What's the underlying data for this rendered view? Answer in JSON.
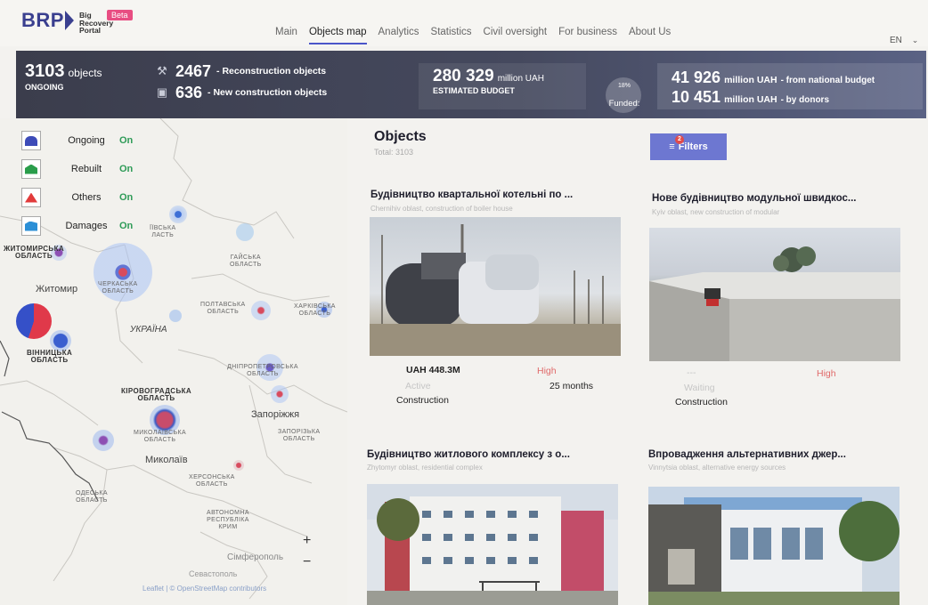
{
  "header": {
    "logo_text": "BRP",
    "logo_lines": [
      "Big",
      "Recovery",
      "Portal"
    ],
    "beta_badge": "Beta",
    "nav": [
      "Main",
      "Objects map",
      "Analytics",
      "Statistics",
      "Civil oversight",
      "For business",
      "About Us"
    ],
    "active_nav": "Objects map",
    "language": "EN"
  },
  "stats": {
    "ongoing_count": "3103",
    "ongoing_unit": "objects",
    "ongoing_label": "ONGOING",
    "reconstruction_count": "2467",
    "reconstruction_label": "- Reconstruction objects",
    "new_count": "636",
    "new_label": "- New construction objects",
    "budget_value": "280 329",
    "budget_unit": "million UAH",
    "budget_label": "ESTIMATED BUDGET",
    "funded_pct": "18%",
    "funded_label": "Funded:",
    "national_value": "41 926",
    "national_unit": "million UAH",
    "national_label": "- from national budget",
    "donors_value": "10 451",
    "donors_unit": "million UAH",
    "donors_label": "- by donors"
  },
  "legend": [
    {
      "label": "Ongoing",
      "state": "On",
      "icon": "ongoing-icon",
      "color": "#3d4bb8"
    },
    {
      "label": "Rebuilt",
      "state": "On",
      "icon": "rebuilt-icon",
      "color": "#2a9d4b"
    },
    {
      "label": "Others",
      "state": "On",
      "icon": "others-icon",
      "color": "#e23b3b"
    },
    {
      "label": "Damages",
      "state": "On",
      "icon": "damages-icon",
      "color": "#2b8fd6"
    }
  ],
  "map": {
    "regions": {
      "kyiv": "ЇЇВСЬКА\nЛАСТЬ",
      "zhytomyr": "ЖИТОМИРСЬКА\nОБЛАСТЬ",
      "chernihiv": "ГАЙСЬКА\nОБЛАСТЬ",
      "poltava": "ПОЛТАВСЬКА\nОБЛАСТЬ",
      "kharkiv": "ХАРКІВСЬКА\nОБЛАСТЬ",
      "cherkasy": "ЧЕРКАСЬКА\nОБЛАСТЬ",
      "vinnytsia": "ВІННИЦЬКА\nОБЛАСТЬ",
      "dnipro": "ДНІПРОПЕТРОВСЬКА\nОБЛАСТЬ",
      "kirovohrad": "КІРОВОГРАДСЬКА\nОБЛАСТЬ",
      "zaporizhzhia": "ЗАПОРІЗЬКА\nОБЛАСТЬ",
      "mykolaiv": "МИКОЛАЇВСЬКА\nОБЛАСТЬ",
      "kherson": "ХЕРСОНСЬКА\nОБЛАСТЬ",
      "odesa": "ОДЕСЬКА\nОБЛАСТЬ",
      "crimea": "АВТОНОМНА\nРЕСПУБЛІКА\nКРИМ"
    },
    "cities": {
      "zhytomyr": "Житомир",
      "ukraine": "УКРАЇНА",
      "zaporizhzhia": "Запоріжжя",
      "mykolaiv": "Миколаїв",
      "simferopol": "Сімферополь",
      "sevastopol": "Севастополь"
    },
    "zoom_in": "+",
    "zoom_out": "−",
    "attribution": "Leaflet | © OpenStreetMap contributors"
  },
  "objects": {
    "title": "Objects",
    "subtitle": "Total: 3103",
    "filters_label": "Filters",
    "filters_count": "2",
    "cards": [
      {
        "title": "Будівництво квартальної котельні по ...",
        "subtitle": "Chernihiv oblast, construction of boiler house",
        "amount": "UAH 448.3M",
        "priority": "High",
        "status": "Active",
        "duration": "25 months",
        "type": "Construction"
      },
      {
        "title": "Нове будівництво модульної швидкос...",
        "subtitle": "Kyiv oblast, new construction of modular",
        "amount": "---",
        "priority": "High",
        "status": "Waiting",
        "duration": "",
        "type": "Construction"
      },
      {
        "title": "Будівництво житлового комплексу з о...",
        "subtitle": "Zhytomyr oblast, residential complex",
        "amount": "",
        "priority": "",
        "status": "",
        "duration": "",
        "type": ""
      },
      {
        "title": "Впровадження альтернативних джер...",
        "subtitle": "Vinnytsia oblast, alternative energy sources",
        "amount": "",
        "priority": "",
        "status": "",
        "duration": "",
        "type": ""
      }
    ]
  }
}
